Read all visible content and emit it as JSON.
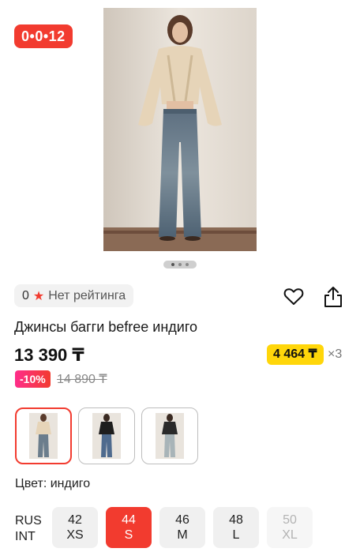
{
  "gallery": {
    "timer": "0•0•12",
    "slides": 3,
    "active_slide": 0
  },
  "rating": {
    "count": "0",
    "label": "Нет рейтинга"
  },
  "product": {
    "title": "Джинсы багги befree индиго",
    "price": "13 390 ₸",
    "installment_price": "4 464 ₸",
    "installment_multiplier": "×3",
    "discount": "-10%",
    "old_price": "14 890 ₸"
  },
  "color": {
    "label": "Цвет: индиго",
    "options_count": 3,
    "selected_index": 0
  },
  "sizes": {
    "system_top": "RUS",
    "system_bottom": "INT",
    "options": [
      {
        "rus": "42",
        "int": "XS",
        "state": "available"
      },
      {
        "rus": "44",
        "int": "S",
        "state": "selected"
      },
      {
        "rus": "46",
        "int": "M",
        "state": "available"
      },
      {
        "rus": "48",
        "int": "L",
        "state": "available"
      },
      {
        "rus": "50",
        "int": "XL",
        "state": "disabled"
      }
    ]
  },
  "colors": {
    "accent": "#f23b2f",
    "installment": "#ffd60a",
    "discount_gradient_start": "#ff2d8a"
  },
  "icons": [
    "star-icon",
    "heart-icon",
    "share-icon"
  ]
}
